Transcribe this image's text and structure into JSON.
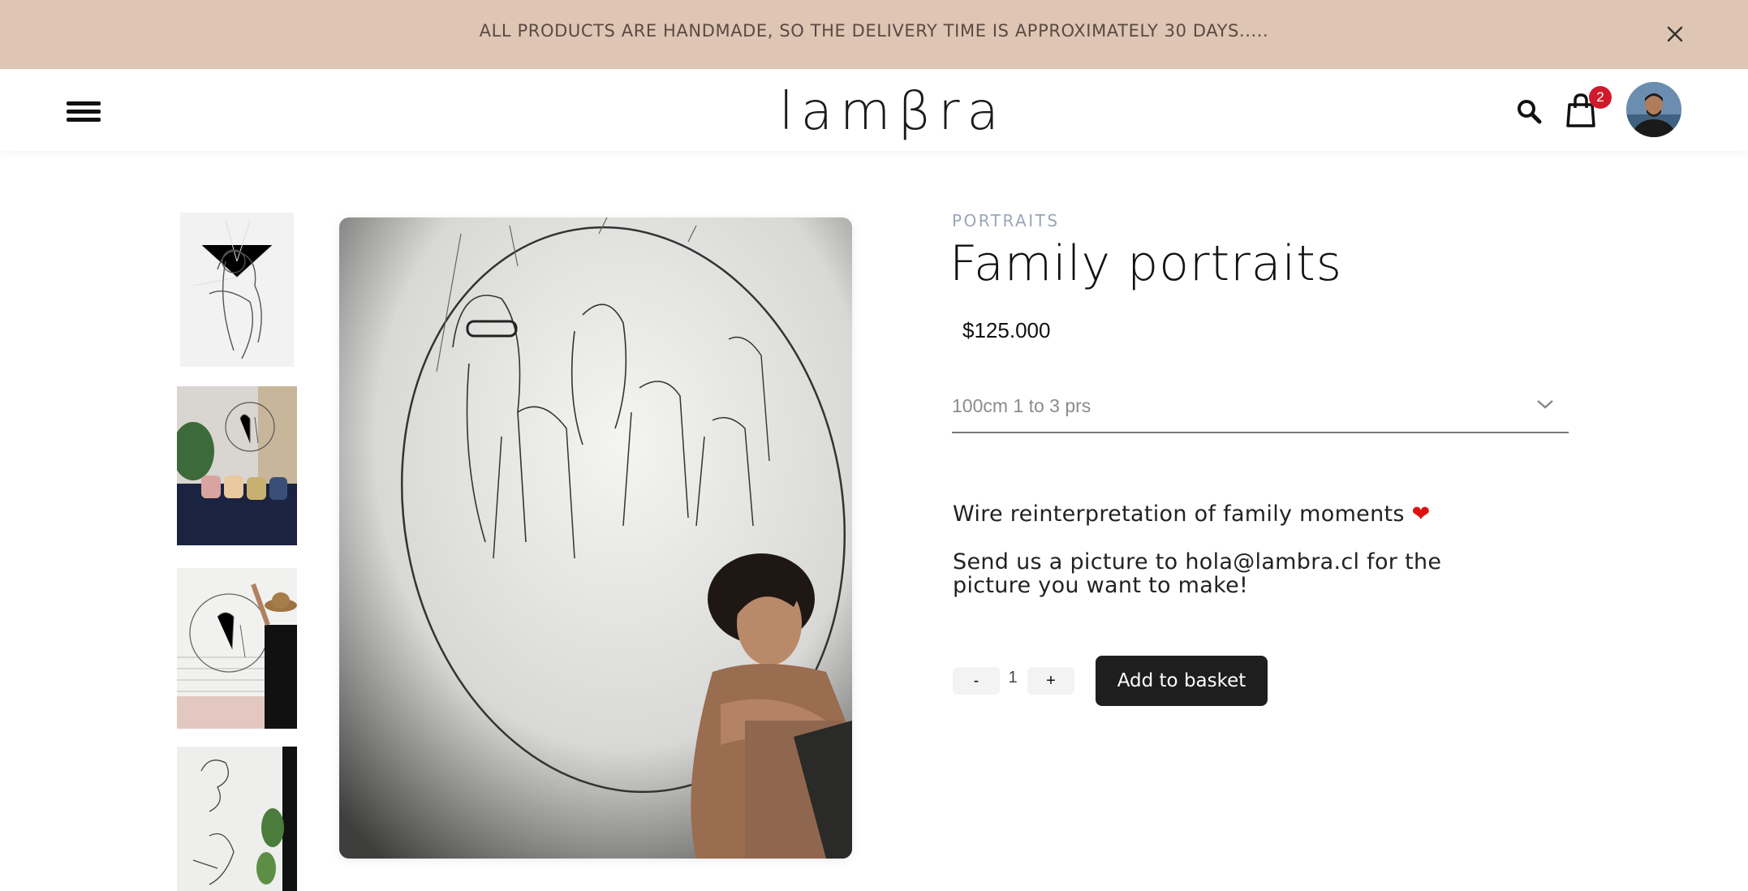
{
  "announcement": {
    "text": "ALL PRODUCTS ARE HANDMADE, SO THE DELIVERY TIME IS APPROXIMATELY 30 DAYS.....",
    "close_icon": "close-icon"
  },
  "header": {
    "menu_icon": "hamburger-menu-icon",
    "logo_text": "lamβra",
    "search_icon": "search-icon",
    "cart_icon": "shopping-bag-icon",
    "cart_count": "2",
    "avatar": "user-avatar"
  },
  "gallery": {
    "thumbnails": [
      "wire-hug-thumbnail",
      "living-room-wall-thumbnail",
      "woman-hanging-wire-art-thumbnail",
      "wire-faces-plant-thumbnail"
    ],
    "main_image": "family-wire-portrait-with-woman"
  },
  "product": {
    "category": "PORTRAITS",
    "title": "Family portraits",
    "price": "$125.000",
    "variant_selected": "100cm 1 to 3 prs",
    "description_line1": "Wire reinterpretation of family moments",
    "description_line2": "Send us a picture to hola@lambra.cl for the picture you want to make!",
    "quantity": {
      "minus": "-",
      "value": "1",
      "plus": "+"
    },
    "add_to_basket": "Add to basket"
  },
  "colors": {
    "announcement_bg": "#dfc5b4",
    "badge": "#d0192b",
    "button": "#1e1e1e",
    "category": "#9aa6b8"
  }
}
